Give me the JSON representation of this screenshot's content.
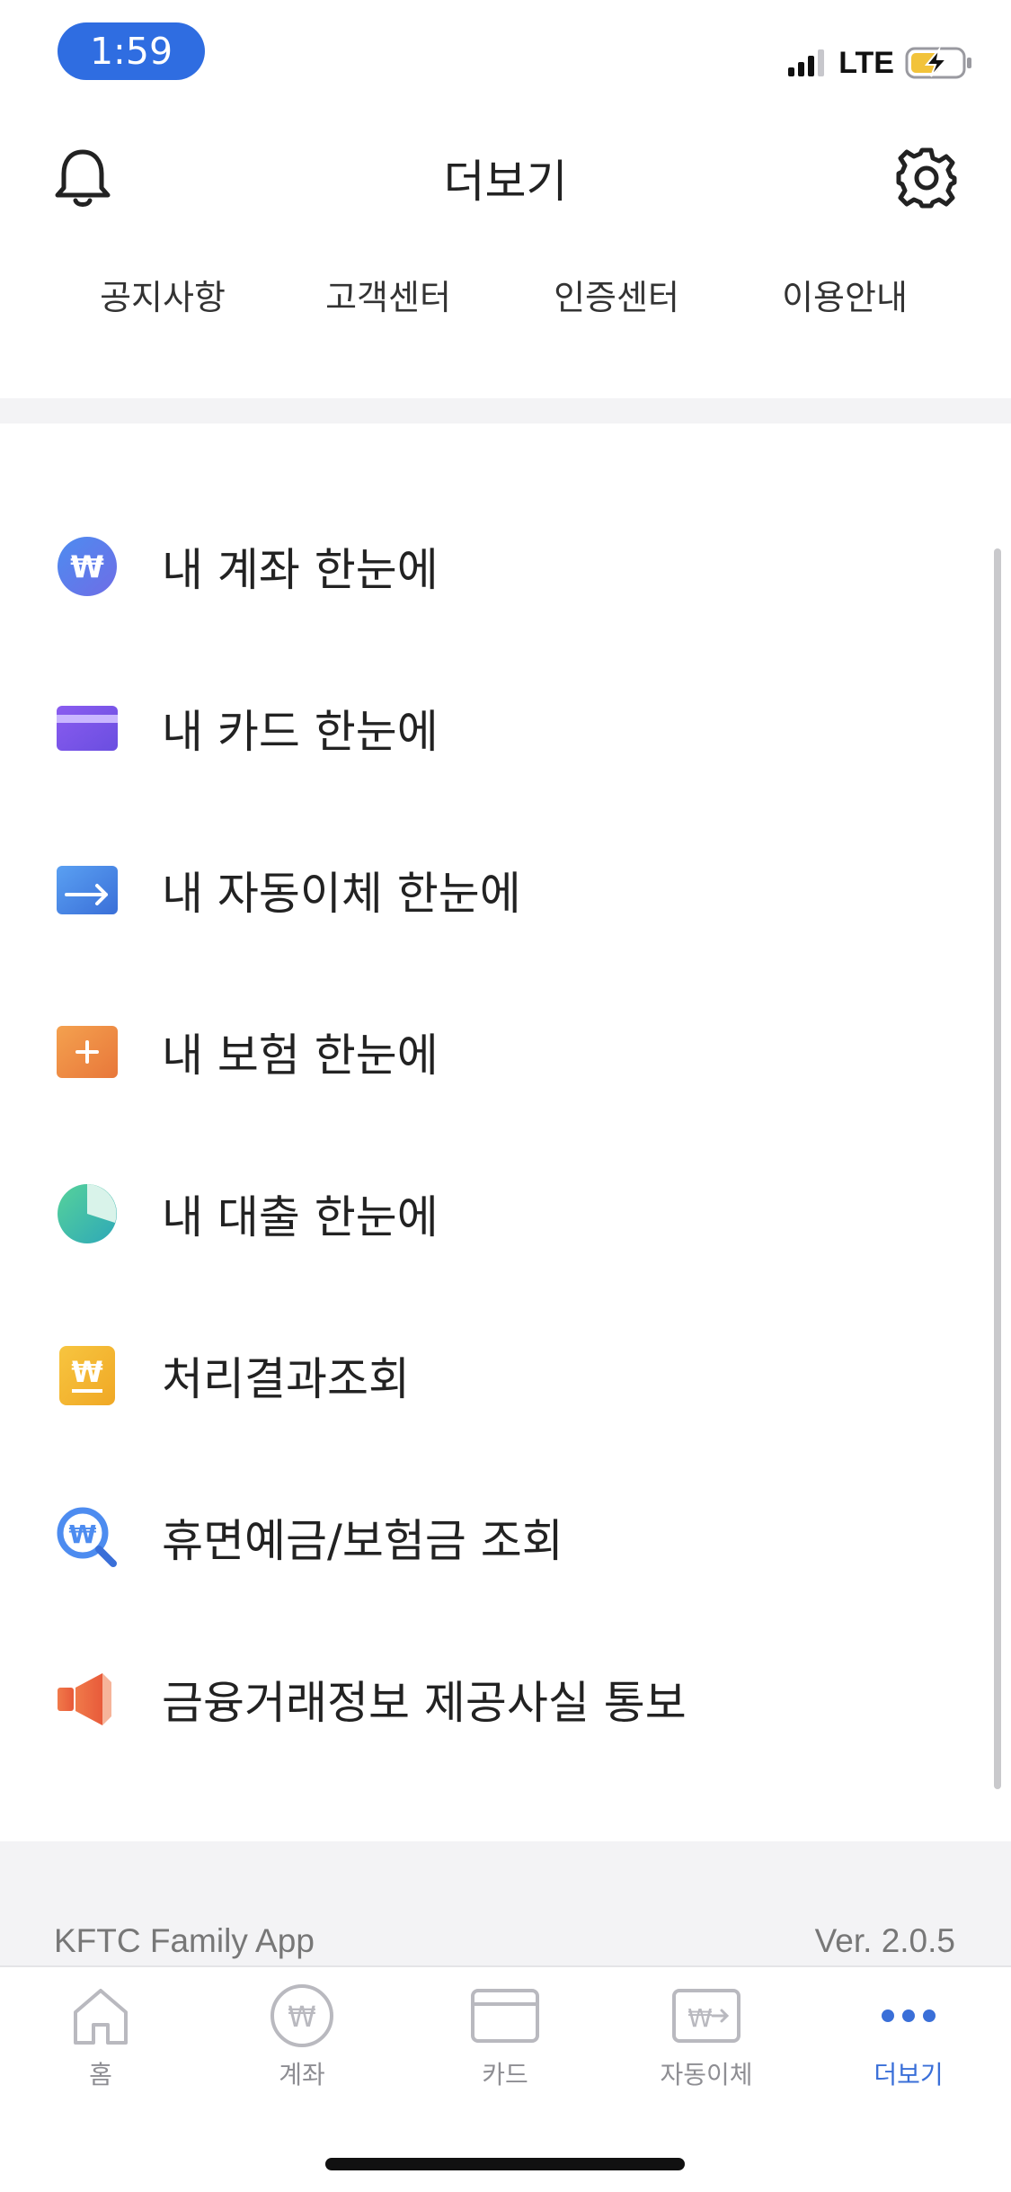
{
  "status_bar": {
    "time": "1:59",
    "network": "LTE"
  },
  "header": {
    "title": "더보기"
  },
  "quick_links": [
    "공지사항",
    "고객센터",
    "인증센터",
    "이용안내"
  ],
  "menu": [
    {
      "label": "내 계좌 한눈에",
      "icon": "won-circle-icon"
    },
    {
      "label": "내 카드 한눈에",
      "icon": "card-icon"
    },
    {
      "label": "내 자동이체 한눈에",
      "icon": "transfer-arrow-icon"
    },
    {
      "label": "내 보험 한눈에",
      "icon": "insurance-plus-icon"
    },
    {
      "label": "내 대출 한눈에",
      "icon": "loan-pie-icon"
    },
    {
      "label": "처리결과조회",
      "icon": "won-receipt-icon"
    },
    {
      "label": "휴면예금/보험금 조회",
      "icon": "won-search-icon"
    },
    {
      "label": "금융거래정보 제공사실 통보",
      "icon": "megaphone-icon"
    }
  ],
  "footer": {
    "app_name": "KFTC Family App",
    "version": "Ver. 2.0.5"
  },
  "tabs": [
    {
      "label": "홈",
      "icon": "home-icon",
      "active": false
    },
    {
      "label": "계좌",
      "icon": "account-won-icon",
      "active": false
    },
    {
      "label": "카드",
      "icon": "card-tab-icon",
      "active": false
    },
    {
      "label": "자동이체",
      "icon": "auto-transfer-icon",
      "active": false
    },
    {
      "label": "더보기",
      "icon": "more-dots-icon",
      "active": true
    }
  ],
  "colors": {
    "accent": "#3a6fd8",
    "time_pill": "#2f6de1",
    "inactive": "#8e8e93"
  }
}
